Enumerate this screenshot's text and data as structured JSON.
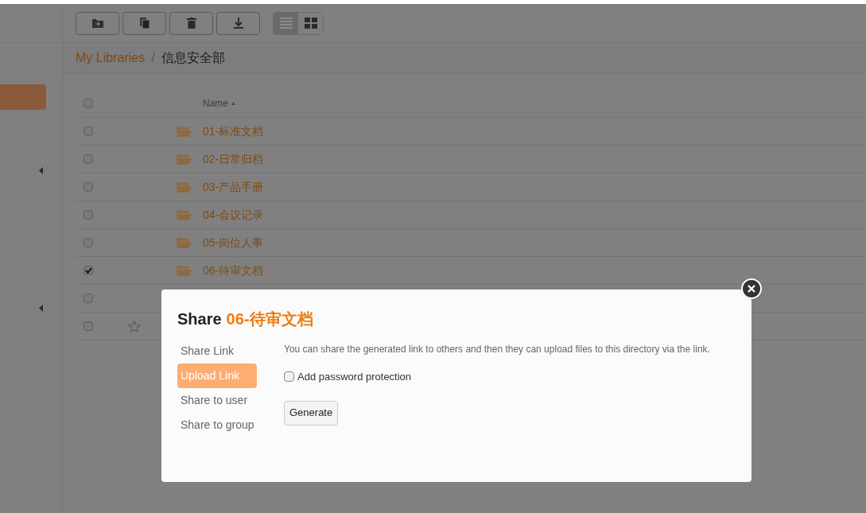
{
  "toolbar": {
    "view_modes": [
      {
        "kind": "list",
        "selected": true
      },
      {
        "kind": "grid",
        "selected": false
      }
    ]
  },
  "breadcrumb": {
    "root": "My Libraries",
    "separator": "/",
    "current": "信息安全部"
  },
  "table": {
    "select_all": false,
    "name_header": "Name",
    "sort_arrow": "▲",
    "rows": [
      {
        "kind": "folder",
        "name": "01-标准文档",
        "checked": false
      },
      {
        "kind": "folder",
        "name": "02-日常归档",
        "checked": false
      },
      {
        "kind": "folder",
        "name": "03-产品手册",
        "checked": false
      },
      {
        "kind": "folder",
        "name": "04-会议记录",
        "checked": false
      },
      {
        "kind": "folder",
        "name": "05-岗位人事",
        "checked": false
      },
      {
        "kind": "folder",
        "name": "06-待审文档",
        "checked": true
      },
      {
        "kind": "covered",
        "checked": false
      },
      {
        "kind": "covered-star",
        "checked": false
      }
    ]
  },
  "dialog": {
    "title": "Share",
    "item_name": "06-待审文档",
    "tabs": [
      {
        "label": "Share Link",
        "selected": false
      },
      {
        "label": "Upload Link",
        "selected": true
      },
      {
        "label": "Share to user",
        "selected": false
      },
      {
        "label": "Share to group",
        "selected": false
      }
    ],
    "description": "You can share the generated link to others and then they can upload files to this directory via the link.",
    "password": {
      "label": "Add password protection",
      "checked": false
    },
    "button": "Generate"
  }
}
